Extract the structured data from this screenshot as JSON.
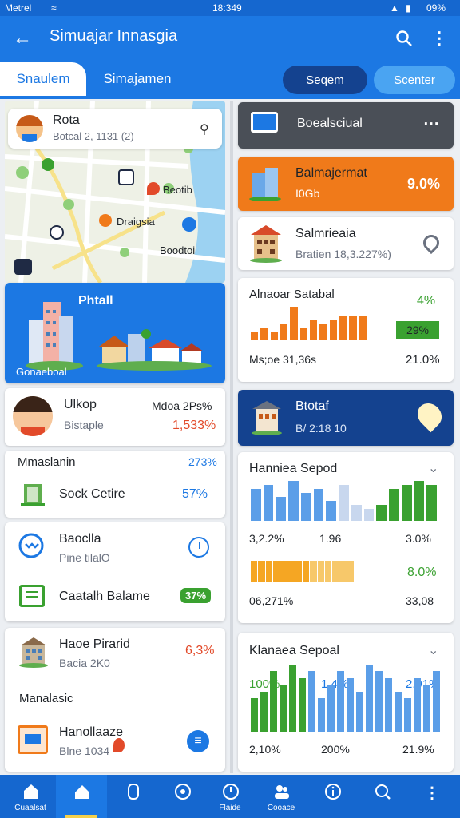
{
  "status": {
    "carrier": "Metrel",
    "time": "18:349",
    "battery": "09%"
  },
  "appbar": {
    "title": "Simuajar Innasgia"
  },
  "tabs": [
    {
      "label": "Snaulem"
    },
    {
      "label": "Simajamen"
    }
  ],
  "pills": [
    {
      "label": "Seqem"
    },
    {
      "label": "Scenter"
    }
  ],
  "map_card": {
    "title": "Rota",
    "subtitle": "Botcal 2, 1131 (2)",
    "pins": [
      "Beotib",
      "Draigsia",
      "Boodtoi"
    ]
  },
  "hero": {
    "title": "Phtall",
    "caption": "Gonaeboal"
  },
  "left_cards": [
    {
      "title": "Ulkop",
      "subtitle": "Bistaple",
      "meta": "Mdoa 2Ps%",
      "value": "1,533%"
    },
    {
      "header": "Mmaslanin",
      "header_value": "273%",
      "label": "Sock Cetire",
      "value": "57%"
    },
    {
      "title": "Baoclla",
      "subtitle": "Pine tilalO",
      "label": "Caatalh Balame",
      "badge": "37%"
    },
    {
      "title": "Haoe Pirarid",
      "subtitle": "Bacia 2K0",
      "value": "6,3%",
      "section": "Manalasic",
      "item_title": "Hanollaaze",
      "item_subtitle": "Blne 1034"
    }
  ],
  "right_cards": {
    "header": {
      "title": "Boealsciual"
    },
    "orange": {
      "title": "Balmajermat",
      "subtitle": "I0Gb",
      "value": "9.0%"
    },
    "building": {
      "title": "Salmrieaia",
      "subtitle": "Bratien 18,3.227%)"
    },
    "chart1": {
      "title": "Alnaoar Satabal",
      "value_top": "4%",
      "badge": "29%",
      "footer_left": "Ms;oe 31,36s",
      "footer_right": "21.0%"
    },
    "blue": {
      "title": "Btotaf",
      "subtitle": "B/ 2:18 10"
    },
    "chart2": {
      "title": "Hanniea Sepod",
      "row1": [
        "3,2.2%",
        "1.96",
        "3.0%"
      ],
      "value_mid": "8.0%",
      "row2": [
        "06,271%",
        "33,08"
      ]
    },
    "chart3": {
      "title": "Klanaea Sepoal",
      "labels_top": [
        "100%",
        "1.4%",
        "2.91%"
      ],
      "labels_bottom": [
        "2,10%",
        "200%",
        "21.9%"
      ]
    }
  },
  "bottom_nav": [
    {
      "label": "Cuaalsat",
      "icon": "home-icon"
    },
    {
      "label": "",
      "icon": "house-icon"
    },
    {
      "label": "",
      "icon": "clip-icon"
    },
    {
      "label": "",
      "icon": "chat-icon"
    },
    {
      "label": "Flaide",
      "icon": "clock-icon"
    },
    {
      "label": "Cooace",
      "icon": "people-icon"
    },
    {
      "label": "",
      "icon": "info-icon"
    },
    {
      "label": "",
      "icon": "search-icon"
    },
    {
      "label": "",
      "icon": "more-icon"
    }
  ],
  "colors": {
    "primary": "#1c78e3",
    "dark": "#14428f",
    "orange": "#f07a1a",
    "green": "#3aa130",
    "red": "#e24a2a"
  },
  "chart_data": [
    {
      "type": "bar",
      "title": "Alnaoar Satabal",
      "series": [
        {
          "values": [
            2,
            3,
            2,
            4,
            8,
            3,
            5,
            4,
            5,
            6,
            6,
            6
          ]
        }
      ]
    },
    {
      "type": "bar",
      "title": "Hanniea Sepod",
      "series": [
        {
          "values": [
            8,
            9,
            6,
            10,
            7,
            8,
            5,
            9,
            4,
            3,
            4,
            8,
            9,
            10,
            9
          ]
        },
        {
          "values": [
            5,
            5,
            5,
            5,
            5,
            5,
            5,
            5,
            5,
            5,
            5,
            5,
            5,
            5
          ]
        }
      ]
    },
    {
      "type": "bar",
      "title": "Klanaea Sepoal",
      "series": [
        {
          "values": [
            5,
            6,
            9,
            7,
            10,
            8,
            9,
            5,
            7,
            9,
            8,
            6,
            10,
            9,
            8,
            6,
            5,
            8,
            7,
            9
          ]
        }
      ]
    }
  ]
}
